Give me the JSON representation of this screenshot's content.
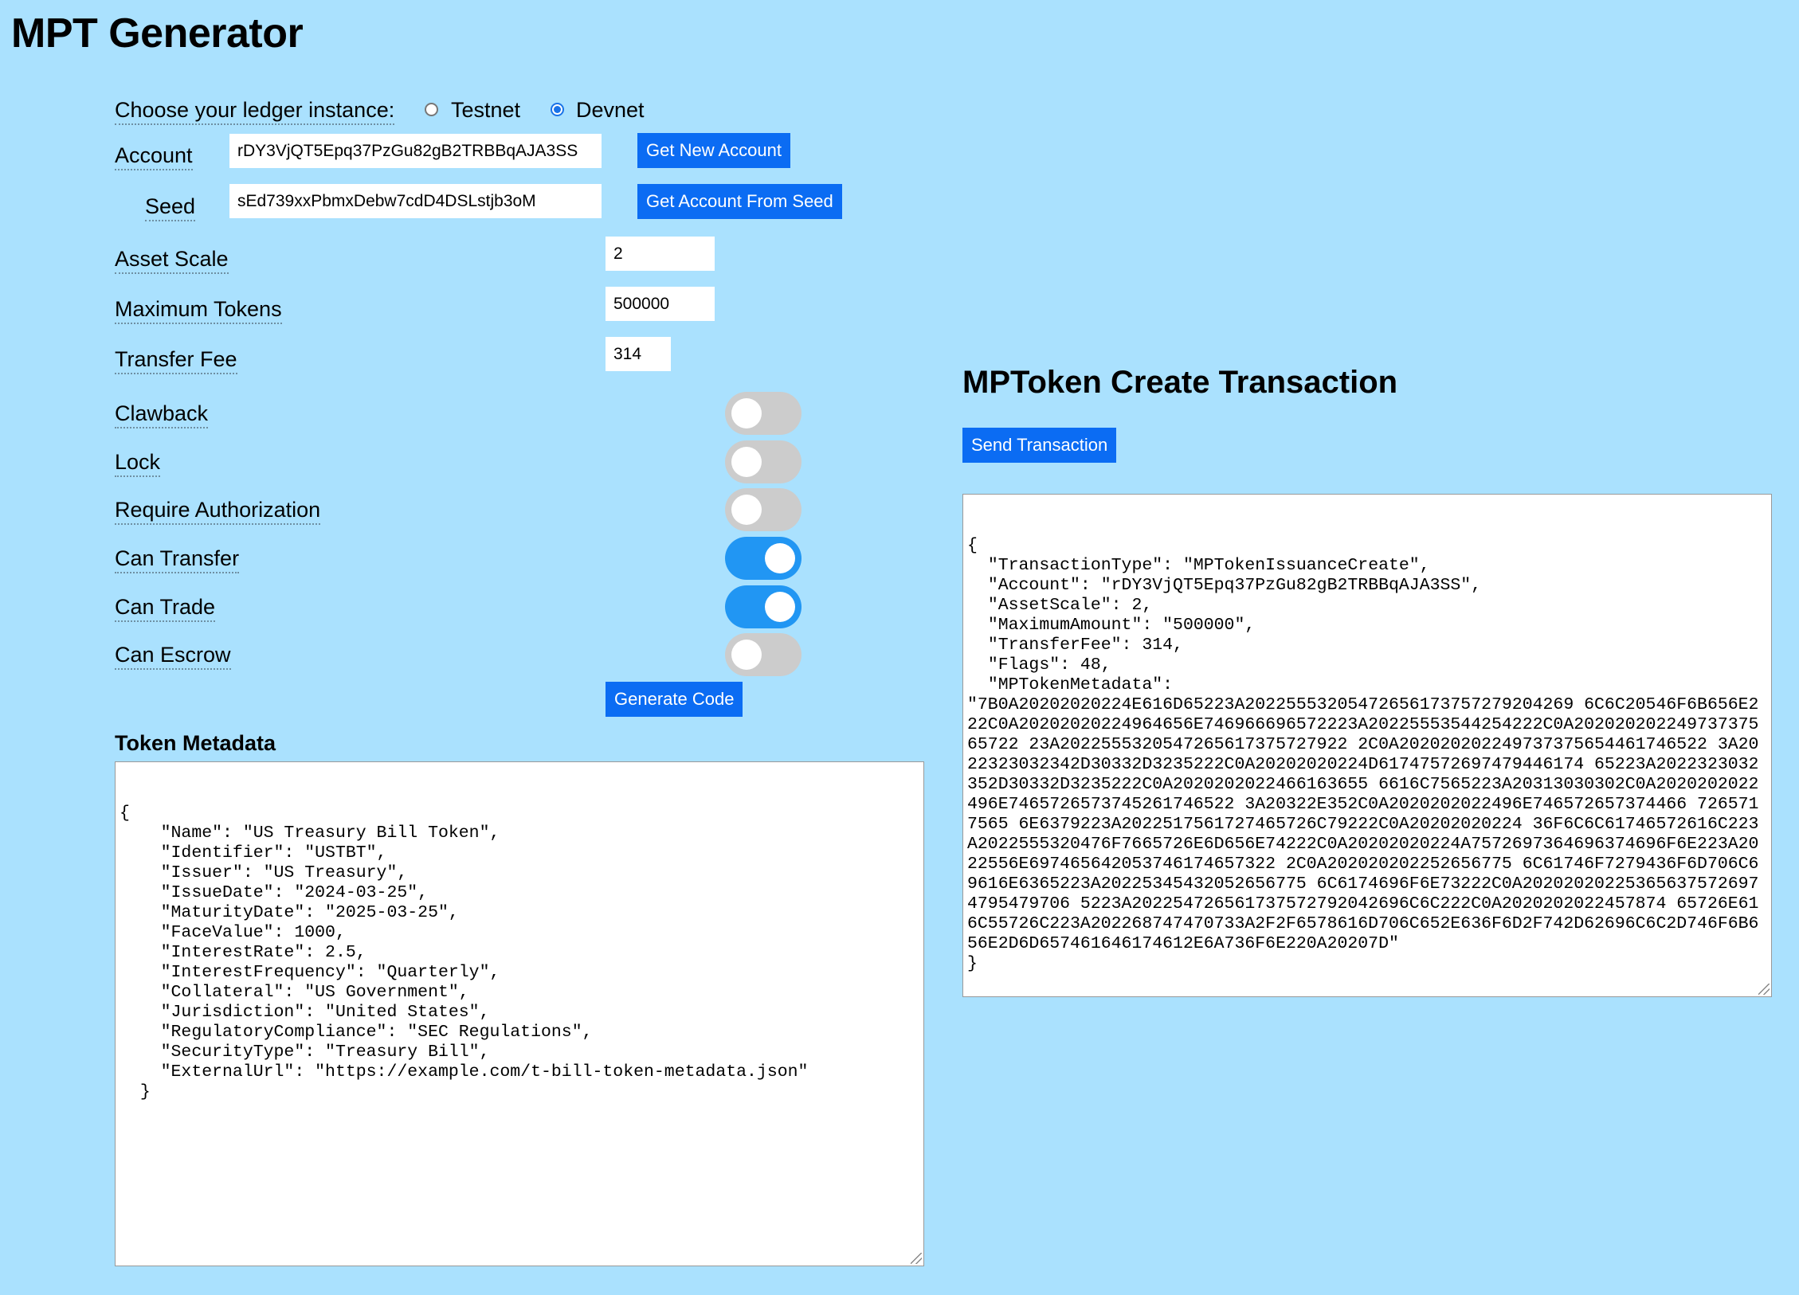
{
  "header": {
    "title": "MPT Generator"
  },
  "ledger": {
    "label": "Choose your ledger instance:",
    "options": [
      {
        "label": "Testnet",
        "checked": false
      },
      {
        "label": "Devnet",
        "checked": true
      }
    ]
  },
  "account": {
    "label": "Account",
    "value": "rDY3VjQT5Epq37PzGu82gB2TRBBqAJA3SS",
    "button": "Get New Account"
  },
  "seed": {
    "label": "Seed",
    "value": "sEd739xxPbmxDebw7cdD4DSLstjb3oM",
    "button": "Get Account From Seed"
  },
  "fields": {
    "asset_scale": {
      "label": "Asset Scale",
      "value": "2"
    },
    "maximum_tokens": {
      "label": "Maximum Tokens",
      "value": "500000"
    },
    "transfer_fee": {
      "label": "Transfer Fee",
      "value": "314"
    }
  },
  "flags": [
    {
      "label": "Clawback",
      "on": false
    },
    {
      "label": "Lock",
      "on": false
    },
    {
      "label": "Require Authorization",
      "on": false
    },
    {
      "label": "Can Transfer",
      "on": true
    },
    {
      "label": "Can Trade",
      "on": true
    },
    {
      "label": "Can Escrow",
      "on": false
    }
  ],
  "generate_button": "Generate Code",
  "metadata": {
    "title": "Token Metadata",
    "text": "{\n    \"Name\": \"US Treasury Bill Token\",\n    \"Identifier\": \"USTBT\",\n    \"Issuer\": \"US Treasury\",\n    \"IssueDate\": \"2024-03-25\",\n    \"MaturityDate\": \"2025-03-25\",\n    \"FaceValue\": 1000,\n    \"InterestRate\": 2.5,\n    \"InterestFrequency\": \"Quarterly\",\n    \"Collateral\": \"US Government\",\n    \"Jurisdiction\": \"United States\",\n    \"RegulatoryCompliance\": \"SEC Regulations\",\n    \"SecurityType\": \"Treasury Bill\",\n    \"ExternalUrl\": \"https://example.com/t-bill-token-metadata.json\"\n  }"
  },
  "transaction": {
    "title": "MPToken Create Transaction",
    "button": "Send Transaction",
    "text": "{\n  \"TransactionType\": \"MPTokenIssuanceCreate\",\n  \"Account\": \"rDY3VjQT5Epq37PzGu82gB2TRBBqAJA3SS\",\n  \"AssetScale\": 2,\n  \"MaximumAmount\": \"500000\",\n  \"TransferFee\": 314,\n  \"Flags\": 48,\n  \"MPTokenMetadata\":\n\"7B0A20202020224E616D65223A20225553205472656173757279204269 6C6C20546F6B656E222C0A20202020224964656E746966696572223A20225553544254222C0A20202020224973737565722 23A2022555320547265617375727922 2C0A202020202249737375654461746522 3A2022323032342D30332D3235222C0A20202020224D61747572697479446174 65223A2022323032352D30332D3235222C0A2020202022466163655 6616C7565223A20313030302C0A2020202022496E7465726573745261746522 3A20322E352C0A2020202022496E746572657374466 7265717565 6E6379223A2022517561727465726C79222C0A20202020224 36F6C6C61746572616C223A2022555320476F7665726E6D656E74222C0A20202020224A7572697364696374696F6E223A2022556E697465642053746174657322 2C0A202020202252656775 6C61746F7279436F6D706C69616E6365223A20225345432052656775 6C6174696F6E73222C0A202020202253656375726974795479706 5223A202254726561737572792042696C6C222C0A2020202022457874 65726E616C55726C223A202268747470733A2F2F6578616D706C652E636F6D2F742D62696C6C2D746F6B656E2D6D657461646174612E6A736F6E220A20207D\"\n}"
  }
}
